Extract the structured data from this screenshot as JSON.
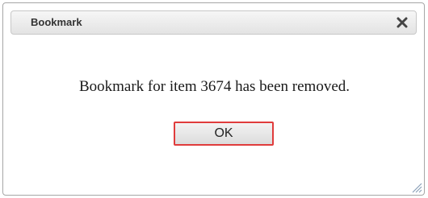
{
  "dialog": {
    "title": "Bookmark",
    "message": "Bookmark for item 3674 has been removed.",
    "ok_label": "OK",
    "close_icon": "close-icon",
    "resize_icon": "resize-grip-icon"
  },
  "colors": {
    "highlight_border": "#e03c3c",
    "titlebar_bg": "#e9e9e9"
  }
}
